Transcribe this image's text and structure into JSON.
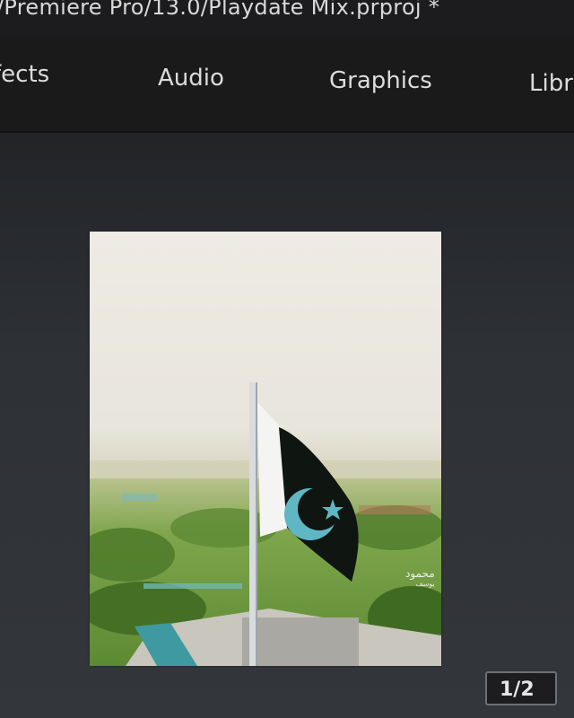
{
  "window": {
    "title_path": "/Premiere Pro/13.0/Playdate Mix.prproj *"
  },
  "workspaces": {
    "effects": "fects",
    "audio": "Audio",
    "graphics": "Graphics",
    "libraries": "Libra"
  },
  "preview": {
    "description_icon": "flag-video-frame",
    "watermark_line1": "محمود",
    "watermark_line2": "يوسف"
  },
  "pager": {
    "label": "1/2"
  },
  "colors": {
    "flag_green": "#0f1510",
    "emblem": "#5fb7c4",
    "sky": "#ece9e2",
    "ui_dark": "#1a1a1b"
  }
}
